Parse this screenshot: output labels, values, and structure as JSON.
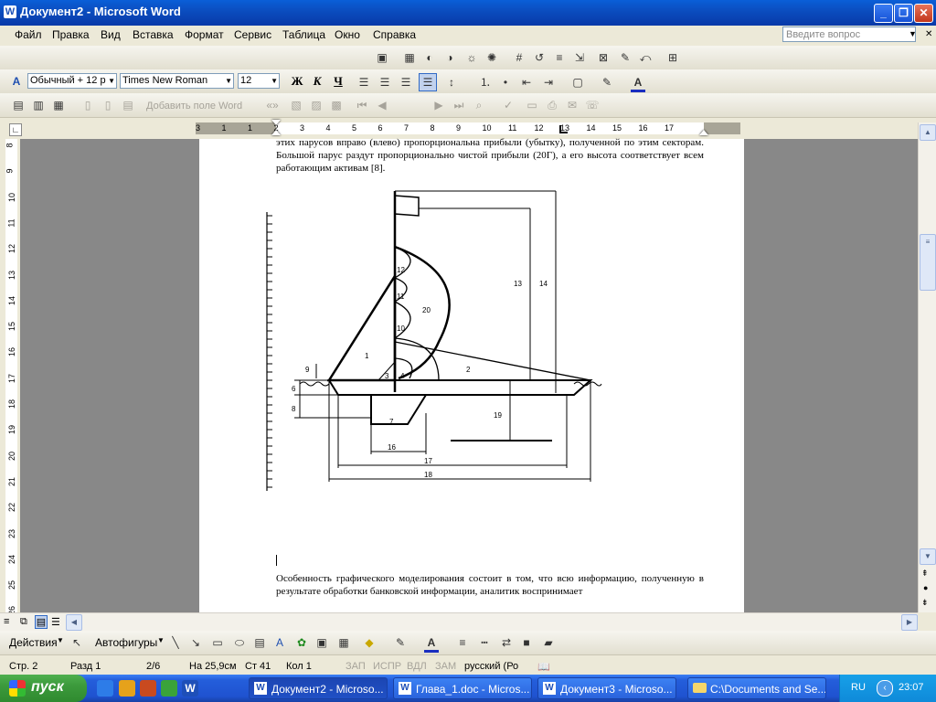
{
  "window": {
    "title": "Документ2 - Microsoft Word",
    "icon": "word-icon"
  },
  "menu": {
    "items": [
      "Файл",
      "Правка",
      "Вид",
      "Вставка",
      "Формат",
      "Сервис",
      "Таблица",
      "Окно",
      "Справка"
    ],
    "ask_placeholder": "Введите вопрос"
  },
  "formatting": {
    "style": "Обычный + 12 р",
    "font": "Times New Roman",
    "size": "12",
    "bold": "Ж",
    "italic": "К",
    "underline": "Ч"
  },
  "mailmerge": {
    "insert_field": "Добавить поле Word"
  },
  "ruler": {
    "h_ticks": [
      "3",
      "1",
      "1",
      "2",
      "3",
      "4",
      "5",
      "6",
      "7",
      "8",
      "9",
      "10",
      "11",
      "12",
      "13",
      "14",
      "15",
      "16",
      "17"
    ],
    "v_ticks": [
      "8",
      "9",
      "10",
      "11",
      "12",
      "13",
      "14",
      "15",
      "16",
      "17",
      "18",
      "19",
      "20",
      "21",
      "22",
      "23",
      "24",
      "25",
      "26"
    ]
  },
  "document": {
    "para1": "этих парусов вправо (влево) пропорциональна прибыли (убытку), полученной  по этим секторам. Большой парус раздут пропорционально чистой прибыли (20Г), а его высота соответствует всем работающим активам [8].",
    "para2": "Особенность графического моделирования состоит в том, что всю информацию, полученную в результате обработки банковской информации, аналитик воспринимает",
    "figure_labels": [
      "1",
      "2",
      "3",
      "4",
      "6",
      "7",
      "8",
      "9",
      "10",
      "11",
      "12",
      "13",
      "14",
      "16",
      "17",
      "18",
      "19",
      "20"
    ]
  },
  "drawing": {
    "actions": "Действия",
    "autoshapes": "Автофигуры"
  },
  "status": {
    "page": "Стр. 2",
    "section": "Разд  1",
    "pages": "2/6",
    "at": "На 25,9см",
    "line": "Ст 41",
    "col": "Кол  1",
    "rec": "ЗАП",
    "trk": "ИСПР",
    "ext": "ВДЛ",
    "ovr": "ЗАМ",
    "lang": "русский (Ро"
  },
  "taskbar": {
    "start": "пуск",
    "tasks": [
      "Документ2 - Microso...",
      "Глава_1.doc - Micros...",
      "Документ3 - Microso...",
      "C:\\Documents and Se..."
    ],
    "lang": "RU",
    "time": "23:07"
  },
  "colors": {
    "titlebar": "#0b4ec0",
    "taskbar": "#245edb",
    "start": "#3c9a3c",
    "tray": "#0f8ad9"
  }
}
